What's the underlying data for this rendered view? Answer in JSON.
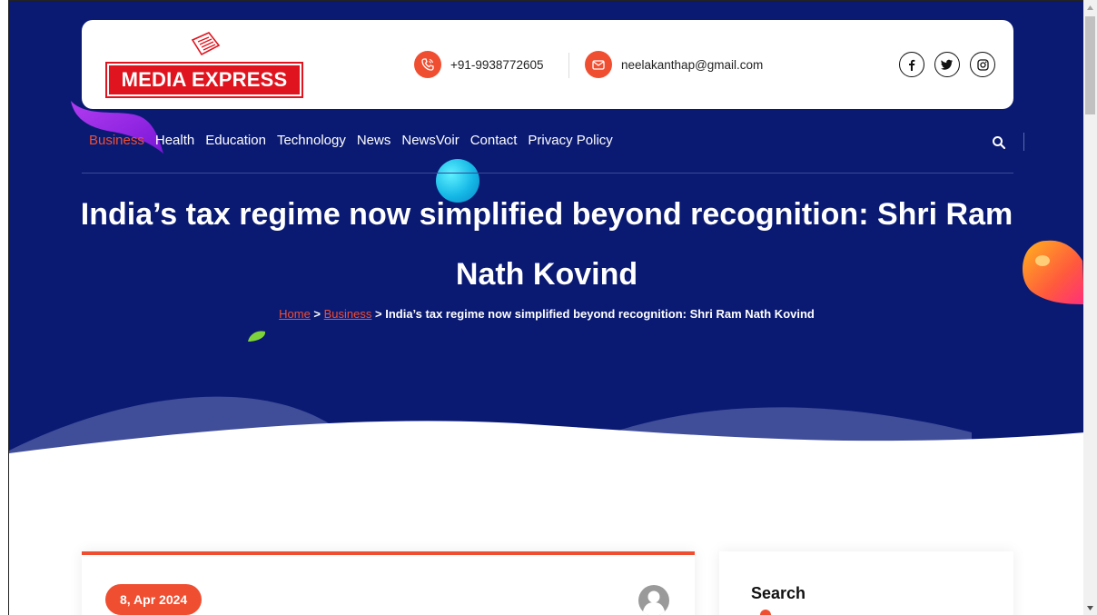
{
  "header": {
    "logo_text": "MEDIA EXPRESS",
    "phone": "+91-9938772605",
    "email": "neelakanthap@gmail.com",
    "social_icons": [
      "facebook-icon",
      "twitter-icon",
      "instagram-icon"
    ]
  },
  "nav": {
    "items": [
      "Business",
      "Health",
      "Education",
      "Technology",
      "News",
      "NewsVoir",
      "Contact",
      "Privacy Policy"
    ],
    "active": "Business"
  },
  "page": {
    "title": "India’s tax regime now simplified beyond recognition: Shri Ram Nath Kovind"
  },
  "breadcrumb": {
    "home": "Home",
    "sep1": " > ",
    "category": "Business",
    "sep2": " > ",
    "current": "India’s tax regime now simplified beyond recognition: Shri Ram Nath Kovind"
  },
  "post": {
    "date": "8, Apr 2024"
  },
  "sidebar": {
    "search_title": "Search"
  },
  "colors": {
    "hero_bg": "#0a1a73",
    "accent": "#f04e31",
    "logo_red": "#e0141e"
  }
}
